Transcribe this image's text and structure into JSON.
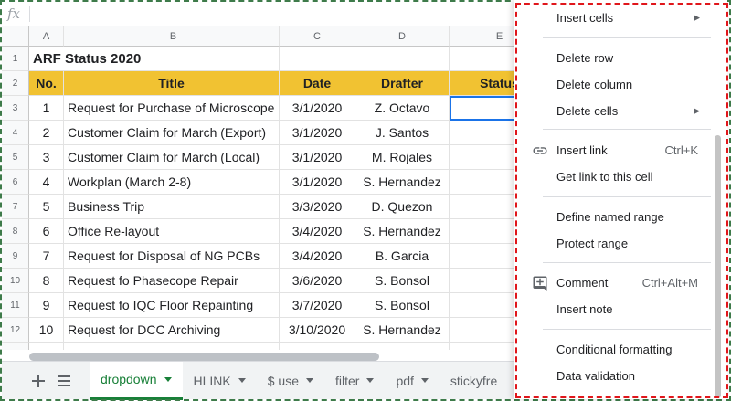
{
  "formula_bar": {
    "icon": "fx-icon",
    "fx_label": "fx"
  },
  "columns": [
    "A",
    "B",
    "C",
    "D",
    "E"
  ],
  "sheet": {
    "title": "ARF Status 2020",
    "headers": [
      "No.",
      "Title",
      "Date",
      "Drafter",
      "Status"
    ],
    "header_color": "#f1c232",
    "rows": [
      {
        "row": "3",
        "no": "1",
        "title": "Request for Purchase of Microscope",
        "date": "3/1/2020",
        "drafter": "Z. Octavo"
      },
      {
        "row": "4",
        "no": "2",
        "title": "Customer Claim for March (Export)",
        "date": "3/1/2020",
        "drafter": "J. Santos"
      },
      {
        "row": "5",
        "no": "3",
        "title": "Customer Claim for March (Local)",
        "date": "3/1/2020",
        "drafter": "M. Rojales"
      },
      {
        "row": "6",
        "no": "4",
        "title": "Workplan (March 2-8)",
        "date": "3/1/2020",
        "drafter": "S. Hernandez"
      },
      {
        "row": "7",
        "no": "5",
        "title": "Business Trip",
        "date": "3/3/2020",
        "drafter": "D. Quezon"
      },
      {
        "row": "8",
        "no": "6",
        "title": "Office Re-layout",
        "date": "3/4/2020",
        "drafter": "S. Hernandez"
      },
      {
        "row": "9",
        "no": "7",
        "title": "Request for Disposal of NG PCBs",
        "date": "3/4/2020",
        "drafter": "B. Garcia"
      },
      {
        "row": "10",
        "no": "8",
        "title": "Request fo Phasecope Repair",
        "date": "3/6/2020",
        "drafter": "S. Bonsol"
      },
      {
        "row": "11",
        "no": "9",
        "title": "Request fo IQC Floor Repainting",
        "date": "3/7/2020",
        "drafter": "S. Bonsol"
      },
      {
        "row": "12",
        "no": "10",
        "title": "Request for DCC Archiving",
        "date": "3/10/2020",
        "drafter": "S. Hernandez"
      }
    ]
  },
  "tabs": {
    "add_icon": "plus-icon",
    "list_icon": "sheet-list-icon",
    "items": [
      "dropdown",
      "HLINK",
      "$ use",
      "filter",
      "pdf",
      "stickyfre"
    ],
    "active": "dropdown",
    "active_color": "#188038"
  },
  "context_menu": {
    "insert_cells": "Insert cells",
    "delete_row": "Delete row",
    "delete_column": "Delete column",
    "delete_cells": "Delete cells",
    "insert_link": "Insert link",
    "insert_link_shortcut": "Ctrl+K",
    "get_link": "Get link to this cell",
    "define_named_range": "Define named range",
    "protect_range": "Protect range",
    "comment": "Comment",
    "comment_shortcut": "Ctrl+Alt+M",
    "insert_note": "Insert note",
    "conditional_formatting": "Conditional formatting",
    "data_validation": "Data validation",
    "highlight_color": "#e0161b"
  }
}
